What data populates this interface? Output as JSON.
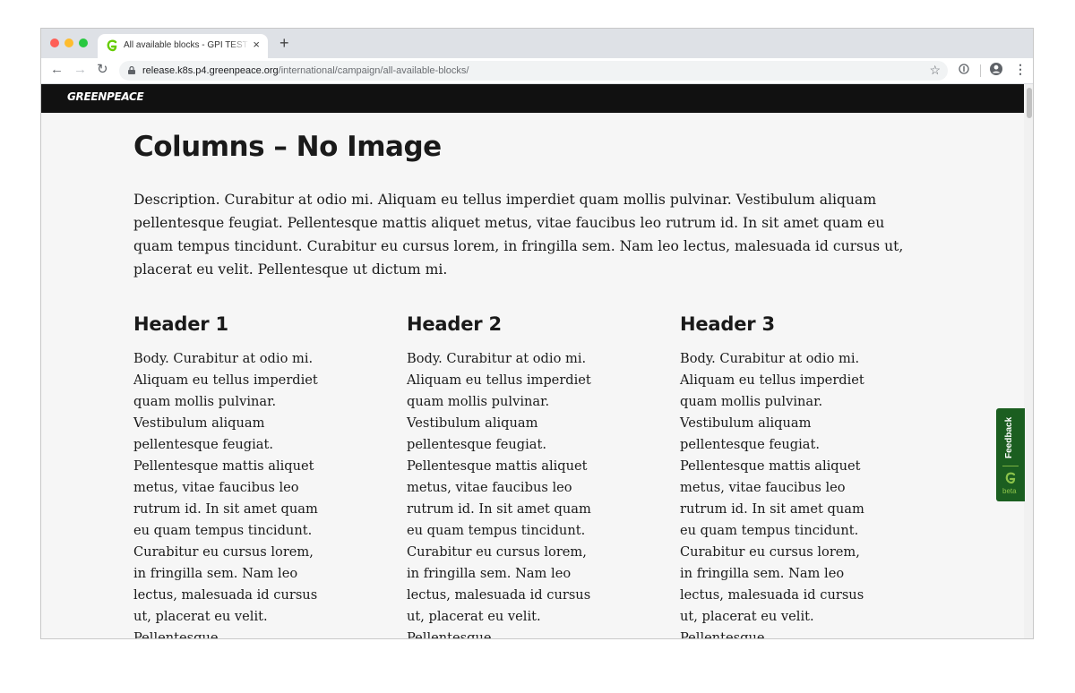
{
  "browser": {
    "tab_title": "All available blocks - GPI TEST SITE",
    "tab_close": "×",
    "new_tab": "+",
    "url_domain": "release.k8s.p4.greenpeace.org",
    "url_path": "/international/campaign/all-available-blocks/",
    "icons": [
      "back-arrow-icon",
      "forward-arrow-icon",
      "reload-icon",
      "lock-icon",
      "star-icon",
      "extension-icon",
      "account-icon",
      "more-menu-icon"
    ]
  },
  "site": {
    "logo": "GREENPEACE"
  },
  "page": {
    "title": "Columns – No Image",
    "description": "Description. Curabitur at odio mi. Aliquam eu tellus imperdiet quam mollis pulvinar. Vestibulum aliquam pellentesque feugiat. Pellentesque mattis aliquet metus, vitae faucibus leo rutrum id. In sit amet quam eu quam tempus tincidunt. Curabitur eu cursus lorem, in fringilla sem. Nam leo lectus, malesuada id cursus ut, placerat eu velit. Pellentesque ut dictum mi.",
    "columns": [
      {
        "header": "Header 1",
        "body": "Body. Curabitur at odio mi. Aliquam eu tellus imperdiet quam mollis pulvinar. Vestibulum aliquam pellentesque feugiat. Pellentesque mattis aliquet metus, vitae faucibus leo rutrum id. In sit amet quam eu quam tempus tincidunt. Curabitur eu cursus lorem, in fringilla sem. Nam leo lectus, malesuada id cursus ut, placerat eu velit. Pellentesque"
      },
      {
        "header": "Header 2",
        "body": "Body. Curabitur at odio mi. Aliquam eu tellus imperdiet quam mollis pulvinar. Vestibulum aliquam pellentesque feugiat. Pellentesque mattis aliquet metus, vitae faucibus leo rutrum id. In sit amet quam eu quam tempus tincidunt. Curabitur eu cursus lorem, in fringilla sem. Nam leo lectus, malesuada id cursus ut, placerat eu velit. Pellentesque"
      },
      {
        "header": "Header 3",
        "body": "Body. Curabitur at odio mi. Aliquam eu tellus imperdiet quam mollis pulvinar. Vestibulum aliquam pellentesque feugiat. Pellentesque mattis aliquet metus, vitae faucibus leo rutrum id. In sit amet quam eu quam tempus tincidunt. Curabitur eu cursus lorem, in fringilla sem. Nam leo lectus, malesuada id cursus ut, placerat eu velit. Pellentesque"
      }
    ]
  },
  "feedback": {
    "label": "Feedback",
    "badge": "beta"
  },
  "colors": {
    "header_bg": "#111111",
    "page_bg": "#f6f6f6",
    "feedback_bg": "#1b5e20",
    "favicon_green": "#66cc00"
  }
}
